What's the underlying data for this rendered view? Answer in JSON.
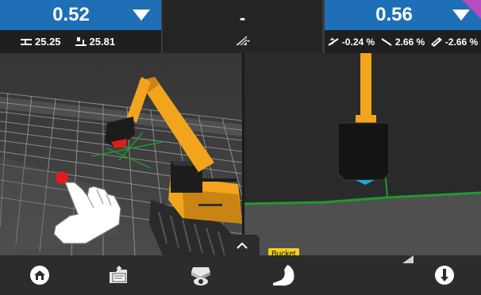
{
  "left_panel": {
    "primary_value": "0.52",
    "stats": [
      {
        "icon": "elevation-offset-icon",
        "value": "25.25"
      },
      {
        "icon": "machine-target-icon",
        "value": "25.81"
      }
    ]
  },
  "middle_panel": {
    "primary_value": "-",
    "stat_icon": "hatch-slope-icon",
    "stat_value": "-"
  },
  "right_panel": {
    "primary_value": "0.56",
    "stats": [
      {
        "icon": "cross-slope-icon",
        "value": "-0.24 %"
      },
      {
        "icon": "main-slope-icon",
        "value": "2.66 %"
      },
      {
        "icon": "design-slope-icon",
        "value": "-2.66 %"
      }
    ]
  },
  "tooltip": {
    "label": "Bucket"
  },
  "colors": {
    "accent_blue": "#1f6fb6",
    "badge_purple": "#b84bbd",
    "machine_yellow": "#f2a51c",
    "design_green": "#1e9a2f",
    "target_red": "#e21b1b"
  },
  "bottom_bar": {
    "buttons": [
      {
        "icon": "home-icon"
      },
      {
        "icon": "plans-folder-icon"
      },
      {
        "icon": "view-camera-icon"
      },
      {
        "icon": "bucket-icon"
      },
      {
        "icon": "alert-icon"
      }
    ]
  }
}
